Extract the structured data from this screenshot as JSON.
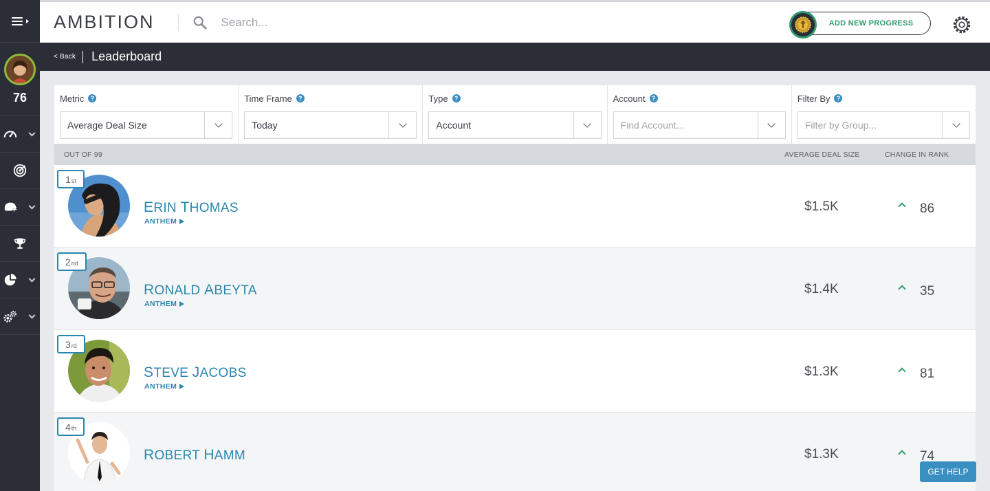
{
  "sidebar": {
    "user_score": "76",
    "items": [
      {
        "icon": "speedometer-icon",
        "has_chevron": true
      },
      {
        "icon": "target-icon",
        "has_chevron": false
      },
      {
        "icon": "helmet-icon",
        "has_chevron": true
      },
      {
        "icon": "trophy-icon",
        "has_chevron": false
      },
      {
        "icon": "pie-chart-icon",
        "has_chevron": true
      },
      {
        "icon": "gears-icon",
        "has_chevron": true
      }
    ]
  },
  "topbar": {
    "logo": "AMBITION",
    "search_placeholder": "Search...",
    "progress_button": "ADD NEW PROGRESS"
  },
  "subheader": {
    "back_label": "< Back",
    "title": "Leaderboard"
  },
  "filters": [
    {
      "label": "Metric",
      "value": "Average Deal Size",
      "placeholder": false
    },
    {
      "label": "Time Frame",
      "value": "Today",
      "placeholder": false
    },
    {
      "label": "Type",
      "value": "Account",
      "placeholder": false
    },
    {
      "label": "Account",
      "value": "Find Account...",
      "placeholder": true
    },
    {
      "label": "Filter By",
      "value": "Filter by Group...",
      "placeholder": true
    }
  ],
  "table": {
    "out_of": "OUT OF 99",
    "metric_header": "AVERAGE DEAL SIZE",
    "change_header": "CHANGE IN RANK",
    "rows": [
      {
        "rank": "1",
        "suffix": "st",
        "name": "Erin Thomas",
        "team": "ANTHEM",
        "metric": "$1.5K",
        "change": "86"
      },
      {
        "rank": "2",
        "suffix": "nd",
        "name": "Ronald Abeyta",
        "team": "ANTHEM",
        "metric": "$1.4K",
        "change": "35"
      },
      {
        "rank": "3",
        "suffix": "rd",
        "name": "Steve Jacobs",
        "team": "ANTHEM",
        "metric": "$1.3K",
        "change": "81"
      },
      {
        "rank": "4",
        "suffix": "th",
        "name": "Robert Hamm",
        "team": "",
        "metric": "$1.3K",
        "change": "74"
      }
    ]
  },
  "help_button": "GET HELP",
  "colors": {
    "dark": "#2b2e36",
    "accent_blue": "#2a86b0",
    "accent_green": "#2e9a6e"
  }
}
